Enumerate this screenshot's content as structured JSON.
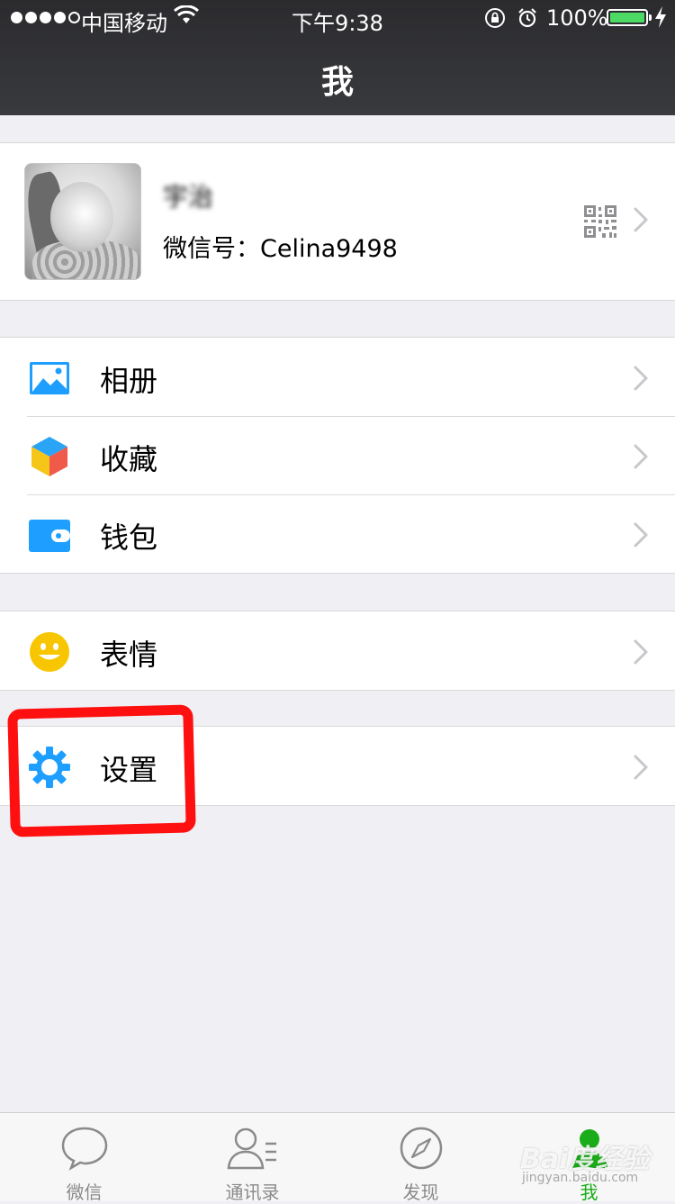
{
  "status_bar": {
    "carrier": "中国移动",
    "time": "下午9:38",
    "battery_percent": "100%",
    "battery_color": "#4cd964"
  },
  "nav": {
    "title": "我"
  },
  "profile": {
    "nickname": "宇治",
    "wechat_id": "微信号：Celina9498",
    "icons": [
      "avatar-photo",
      "qr-code-icon",
      "chevron-right-icon"
    ]
  },
  "menu_groups": [
    [
      {
        "label": "相册",
        "icon": "album-icon"
      },
      {
        "label": "收藏",
        "icon": "favorites-icon"
      },
      {
        "label": "钱包",
        "icon": "wallet-icon"
      }
    ],
    [
      {
        "label": "表情",
        "icon": "sticker-icon"
      }
    ],
    [
      {
        "label": "设置",
        "icon": "settings-gear-icon"
      }
    ]
  ],
  "highlight_color": "#ff1010",
  "tabbar": {
    "tabs": [
      {
        "label": "微信",
        "icon": "chat-bubble-icon",
        "active": false
      },
      {
        "label": "通讯录",
        "icon": "contacts-icon",
        "active": false
      },
      {
        "label": "发现",
        "icon": "compass-icon",
        "active": false
      },
      {
        "label": "我",
        "icon": "me-person-icon",
        "active": true
      }
    ],
    "active_color": "#1aad19",
    "inactive_color": "#8a8a8a"
  },
  "watermark": {
    "text": "Bai度经验",
    "sub": "jingyan.baidu.com"
  }
}
